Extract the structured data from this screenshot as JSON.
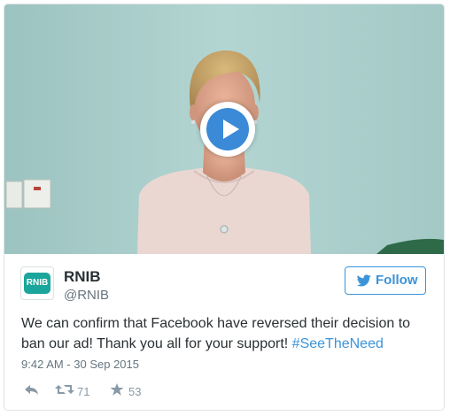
{
  "media": {
    "type": "video"
  },
  "account": {
    "avatar_text": "RNIB",
    "display_name": "RNIB",
    "handle": "@RNIB"
  },
  "follow": {
    "label": "Follow"
  },
  "tweet": {
    "text": "We can confirm that Facebook have reversed their decision to ban our ad! Thank you all for your support! ",
    "hashtag": "#SeeTheNeed",
    "timestamp": "9:42 AM - 30 Sep 2015"
  },
  "actions": {
    "retweet_count": "71",
    "favorite_count": "53"
  },
  "colors": {
    "accent": "#3b94d9",
    "play_button": "#3a8ad7",
    "avatar_bg": "#1aa69c",
    "text": "#292f33",
    "muted": "#66757f"
  },
  "icons": [
    "play-icon",
    "twitter-bird-icon",
    "reply-icon",
    "retweet-icon",
    "star-icon"
  ]
}
